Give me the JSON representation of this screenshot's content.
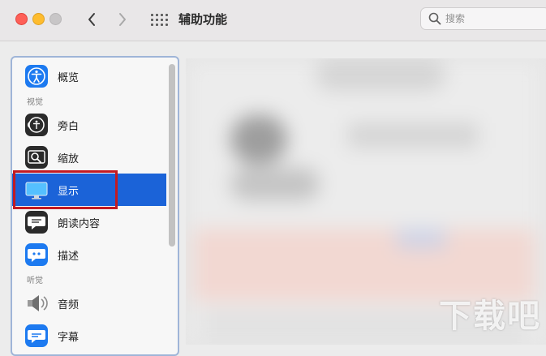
{
  "window": {
    "title": "辅助功能",
    "search_placeholder": "搜索"
  },
  "sidebar": {
    "items": [
      {
        "id": "overview",
        "label": "概览",
        "icon": "accessibility-icon"
      },
      {
        "id": "voiceover",
        "label": "旁白",
        "icon": "voiceover-icon"
      },
      {
        "id": "zoom",
        "label": "缩放",
        "icon": "zoom-icon"
      },
      {
        "id": "display",
        "label": "显示",
        "icon": "display-icon",
        "selected": true
      },
      {
        "id": "spoken",
        "label": "朗读内容",
        "icon": "spoken-content-icon"
      },
      {
        "id": "descriptions",
        "label": "描述",
        "icon": "descriptions-icon"
      },
      {
        "id": "audio",
        "label": "音频",
        "icon": "speaker-icon"
      },
      {
        "id": "captions",
        "label": "字幕",
        "icon": "captions-icon"
      }
    ],
    "sections": {
      "vision": "视觉",
      "hearing": "听觉"
    }
  },
  "colors": {
    "selection": "#1b63d8",
    "annotation_box": "#c21a22",
    "close": "#fe5f57",
    "minimize": "#febc2e"
  },
  "watermark": "下载吧"
}
